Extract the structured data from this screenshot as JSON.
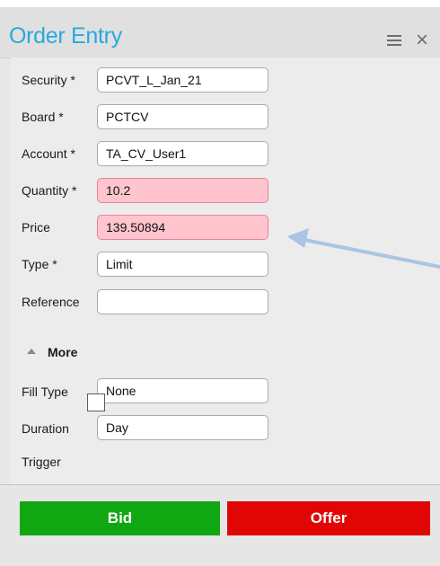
{
  "window": {
    "title": "Order Entry",
    "menu_icon": "hamburger-icon",
    "close_icon": "close-icon",
    "close_glyph": "×"
  },
  "fields": {
    "security": {
      "label": "Security *",
      "value": "PCVT_L_Jan_21"
    },
    "board": {
      "label": "Board *",
      "value": "PCTCV"
    },
    "account": {
      "label": "Account *",
      "value": "TA_CV_User1"
    },
    "quantity": {
      "label": "Quantity *",
      "value": "10.2",
      "invalid": true
    },
    "price": {
      "label": "Price",
      "value": "139.50894",
      "invalid": true
    },
    "type": {
      "label": "Type *",
      "value": "Limit"
    },
    "reference": {
      "label": "Reference",
      "value": ""
    }
  },
  "more": {
    "label": "More",
    "icon": "triangle-up-icon",
    "expanded": true
  },
  "advanced": {
    "fill_type": {
      "label": "Fill Type",
      "value": "None"
    },
    "duration": {
      "label": "Duration",
      "value": "Day"
    },
    "trigger": {
      "label": "Trigger",
      "checked": false
    }
  },
  "actions": {
    "bid_label": "Bid",
    "offer_label": "Offer"
  },
  "colors": {
    "title": "#29a9df",
    "invalid_field": "#ffc4cd",
    "bid": "#10a812",
    "offer": "#e10505",
    "annotation_arrow": "#a9c4e4"
  }
}
